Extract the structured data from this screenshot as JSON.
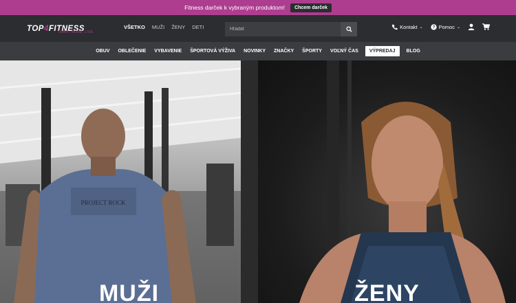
{
  "promo": {
    "text": "Fitness darček k vybraným produktom!",
    "button": "Chcem darček"
  },
  "logo": {
    "main_a": "TOP",
    "main_four": "4",
    "main_b": "FITNESS",
    "tagline": "TRAIN. MORE. LIVE."
  },
  "gender_tabs": [
    "VŠETKO",
    "MUŽI",
    "ŽENY",
    "DETI"
  ],
  "search": {
    "placeholder": "Hľadať"
  },
  "utility": {
    "contact": "Kontakt",
    "help": "Pomoc"
  },
  "categories": [
    "OBUV",
    "OBLEČENIE",
    "VYBAVENIE",
    "ŠPORTOVÁ VÝŽIVA",
    "NOVINKY",
    "ZNAČKY",
    "ŠPORTY",
    "VOĽNÝ ČAS",
    "VÝPREDAJ",
    "BLOG"
  ],
  "hero": {
    "men_title": "MUŽI",
    "women_title": "ŽENY",
    "shirt_print": "PROJECT ROCK"
  },
  "colors": {
    "brand": "#ad3d8f",
    "header": "#2b2d30",
    "nav": "#3a3c40"
  }
}
